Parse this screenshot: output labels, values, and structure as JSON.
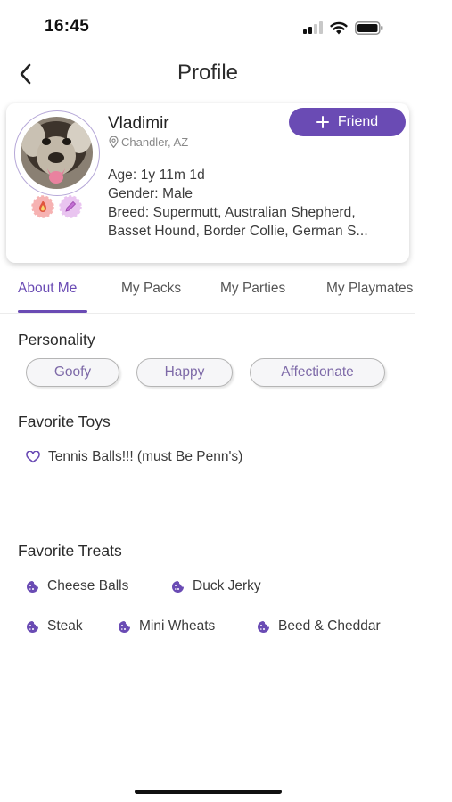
{
  "status": {
    "time": "16:45"
  },
  "header": {
    "title": "Profile"
  },
  "profile": {
    "name": "Vladimir",
    "location": "Chandler, AZ",
    "age": "Age: 1y 11m 1d",
    "gender": "Gender: Male",
    "breed_line1": "Breed: Supermutt, Australian Shepherd,",
    "breed_line2": "Basset Hound, Border Collie, German S...",
    "friend_button_label": "Friend"
  },
  "tabs": [
    {
      "label": "About Me",
      "active": true
    },
    {
      "label": "My Packs"
    },
    {
      "label": "My Parties"
    },
    {
      "label": "My Playmates"
    }
  ],
  "personality": {
    "title": "Personality",
    "traits": [
      "Goofy",
      "Happy",
      "Affectionate"
    ]
  },
  "favorite_toys": {
    "title": "Favorite Toys",
    "items": [
      "Tennis Balls!!! (must Be Penn's)"
    ]
  },
  "favorite_treats": {
    "title": "Favorite Treats",
    "items": [
      "Cheese Balls",
      "Duck Jerky",
      "Steak",
      "Mini Wheats",
      "Beed & Cheddar"
    ]
  },
  "colors": {
    "accent": "#6a4bb4",
    "chip_text": "#7e6aa8"
  }
}
